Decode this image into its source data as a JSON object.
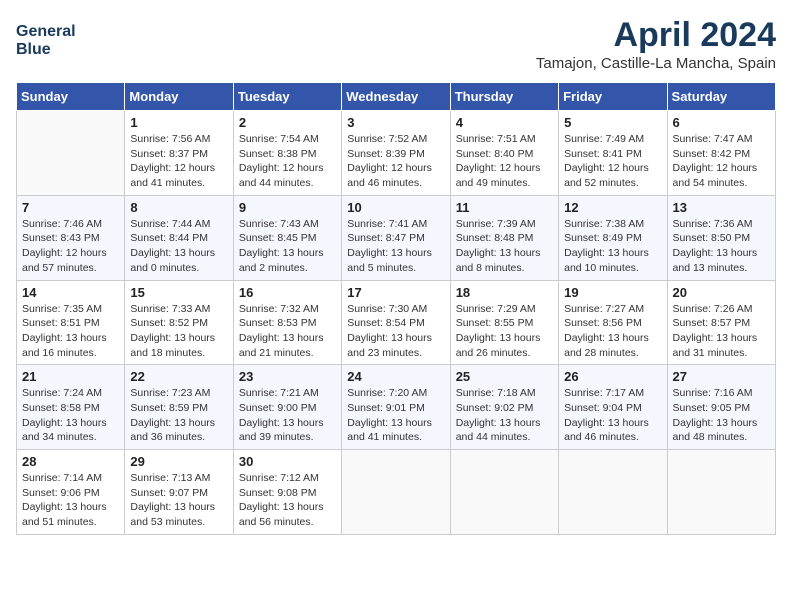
{
  "header": {
    "logo_line1": "General",
    "logo_line2": "Blue",
    "title": "April 2024",
    "subtitle": "Tamajon, Castille-La Mancha, Spain"
  },
  "weekdays": [
    "Sunday",
    "Monday",
    "Tuesday",
    "Wednesday",
    "Thursday",
    "Friday",
    "Saturday"
  ],
  "weeks": [
    [
      {
        "day": "",
        "info": ""
      },
      {
        "day": "1",
        "info": "Sunrise: 7:56 AM\nSunset: 8:37 PM\nDaylight: 12 hours\nand 41 minutes."
      },
      {
        "day": "2",
        "info": "Sunrise: 7:54 AM\nSunset: 8:38 PM\nDaylight: 12 hours\nand 44 minutes."
      },
      {
        "day": "3",
        "info": "Sunrise: 7:52 AM\nSunset: 8:39 PM\nDaylight: 12 hours\nand 46 minutes."
      },
      {
        "day": "4",
        "info": "Sunrise: 7:51 AM\nSunset: 8:40 PM\nDaylight: 12 hours\nand 49 minutes."
      },
      {
        "day": "5",
        "info": "Sunrise: 7:49 AM\nSunset: 8:41 PM\nDaylight: 12 hours\nand 52 minutes."
      },
      {
        "day": "6",
        "info": "Sunrise: 7:47 AM\nSunset: 8:42 PM\nDaylight: 12 hours\nand 54 minutes."
      }
    ],
    [
      {
        "day": "7",
        "info": "Sunrise: 7:46 AM\nSunset: 8:43 PM\nDaylight: 12 hours\nand 57 minutes."
      },
      {
        "day": "8",
        "info": "Sunrise: 7:44 AM\nSunset: 8:44 PM\nDaylight: 13 hours\nand 0 minutes."
      },
      {
        "day": "9",
        "info": "Sunrise: 7:43 AM\nSunset: 8:45 PM\nDaylight: 13 hours\nand 2 minutes."
      },
      {
        "day": "10",
        "info": "Sunrise: 7:41 AM\nSunset: 8:47 PM\nDaylight: 13 hours\nand 5 minutes."
      },
      {
        "day": "11",
        "info": "Sunrise: 7:39 AM\nSunset: 8:48 PM\nDaylight: 13 hours\nand 8 minutes."
      },
      {
        "day": "12",
        "info": "Sunrise: 7:38 AM\nSunset: 8:49 PM\nDaylight: 13 hours\nand 10 minutes."
      },
      {
        "day": "13",
        "info": "Sunrise: 7:36 AM\nSunset: 8:50 PM\nDaylight: 13 hours\nand 13 minutes."
      }
    ],
    [
      {
        "day": "14",
        "info": "Sunrise: 7:35 AM\nSunset: 8:51 PM\nDaylight: 13 hours\nand 16 minutes."
      },
      {
        "day": "15",
        "info": "Sunrise: 7:33 AM\nSunset: 8:52 PM\nDaylight: 13 hours\nand 18 minutes."
      },
      {
        "day": "16",
        "info": "Sunrise: 7:32 AM\nSunset: 8:53 PM\nDaylight: 13 hours\nand 21 minutes."
      },
      {
        "day": "17",
        "info": "Sunrise: 7:30 AM\nSunset: 8:54 PM\nDaylight: 13 hours\nand 23 minutes."
      },
      {
        "day": "18",
        "info": "Sunrise: 7:29 AM\nSunset: 8:55 PM\nDaylight: 13 hours\nand 26 minutes."
      },
      {
        "day": "19",
        "info": "Sunrise: 7:27 AM\nSunset: 8:56 PM\nDaylight: 13 hours\nand 28 minutes."
      },
      {
        "day": "20",
        "info": "Sunrise: 7:26 AM\nSunset: 8:57 PM\nDaylight: 13 hours\nand 31 minutes."
      }
    ],
    [
      {
        "day": "21",
        "info": "Sunrise: 7:24 AM\nSunset: 8:58 PM\nDaylight: 13 hours\nand 34 minutes."
      },
      {
        "day": "22",
        "info": "Sunrise: 7:23 AM\nSunset: 8:59 PM\nDaylight: 13 hours\nand 36 minutes."
      },
      {
        "day": "23",
        "info": "Sunrise: 7:21 AM\nSunset: 9:00 PM\nDaylight: 13 hours\nand 39 minutes."
      },
      {
        "day": "24",
        "info": "Sunrise: 7:20 AM\nSunset: 9:01 PM\nDaylight: 13 hours\nand 41 minutes."
      },
      {
        "day": "25",
        "info": "Sunrise: 7:18 AM\nSunset: 9:02 PM\nDaylight: 13 hours\nand 44 minutes."
      },
      {
        "day": "26",
        "info": "Sunrise: 7:17 AM\nSunset: 9:04 PM\nDaylight: 13 hours\nand 46 minutes."
      },
      {
        "day": "27",
        "info": "Sunrise: 7:16 AM\nSunset: 9:05 PM\nDaylight: 13 hours\nand 48 minutes."
      }
    ],
    [
      {
        "day": "28",
        "info": "Sunrise: 7:14 AM\nSunset: 9:06 PM\nDaylight: 13 hours\nand 51 minutes."
      },
      {
        "day": "29",
        "info": "Sunrise: 7:13 AM\nSunset: 9:07 PM\nDaylight: 13 hours\nand 53 minutes."
      },
      {
        "day": "30",
        "info": "Sunrise: 7:12 AM\nSunset: 9:08 PM\nDaylight: 13 hours\nand 56 minutes."
      },
      {
        "day": "",
        "info": ""
      },
      {
        "day": "",
        "info": ""
      },
      {
        "day": "",
        "info": ""
      },
      {
        "day": "",
        "info": ""
      }
    ]
  ]
}
